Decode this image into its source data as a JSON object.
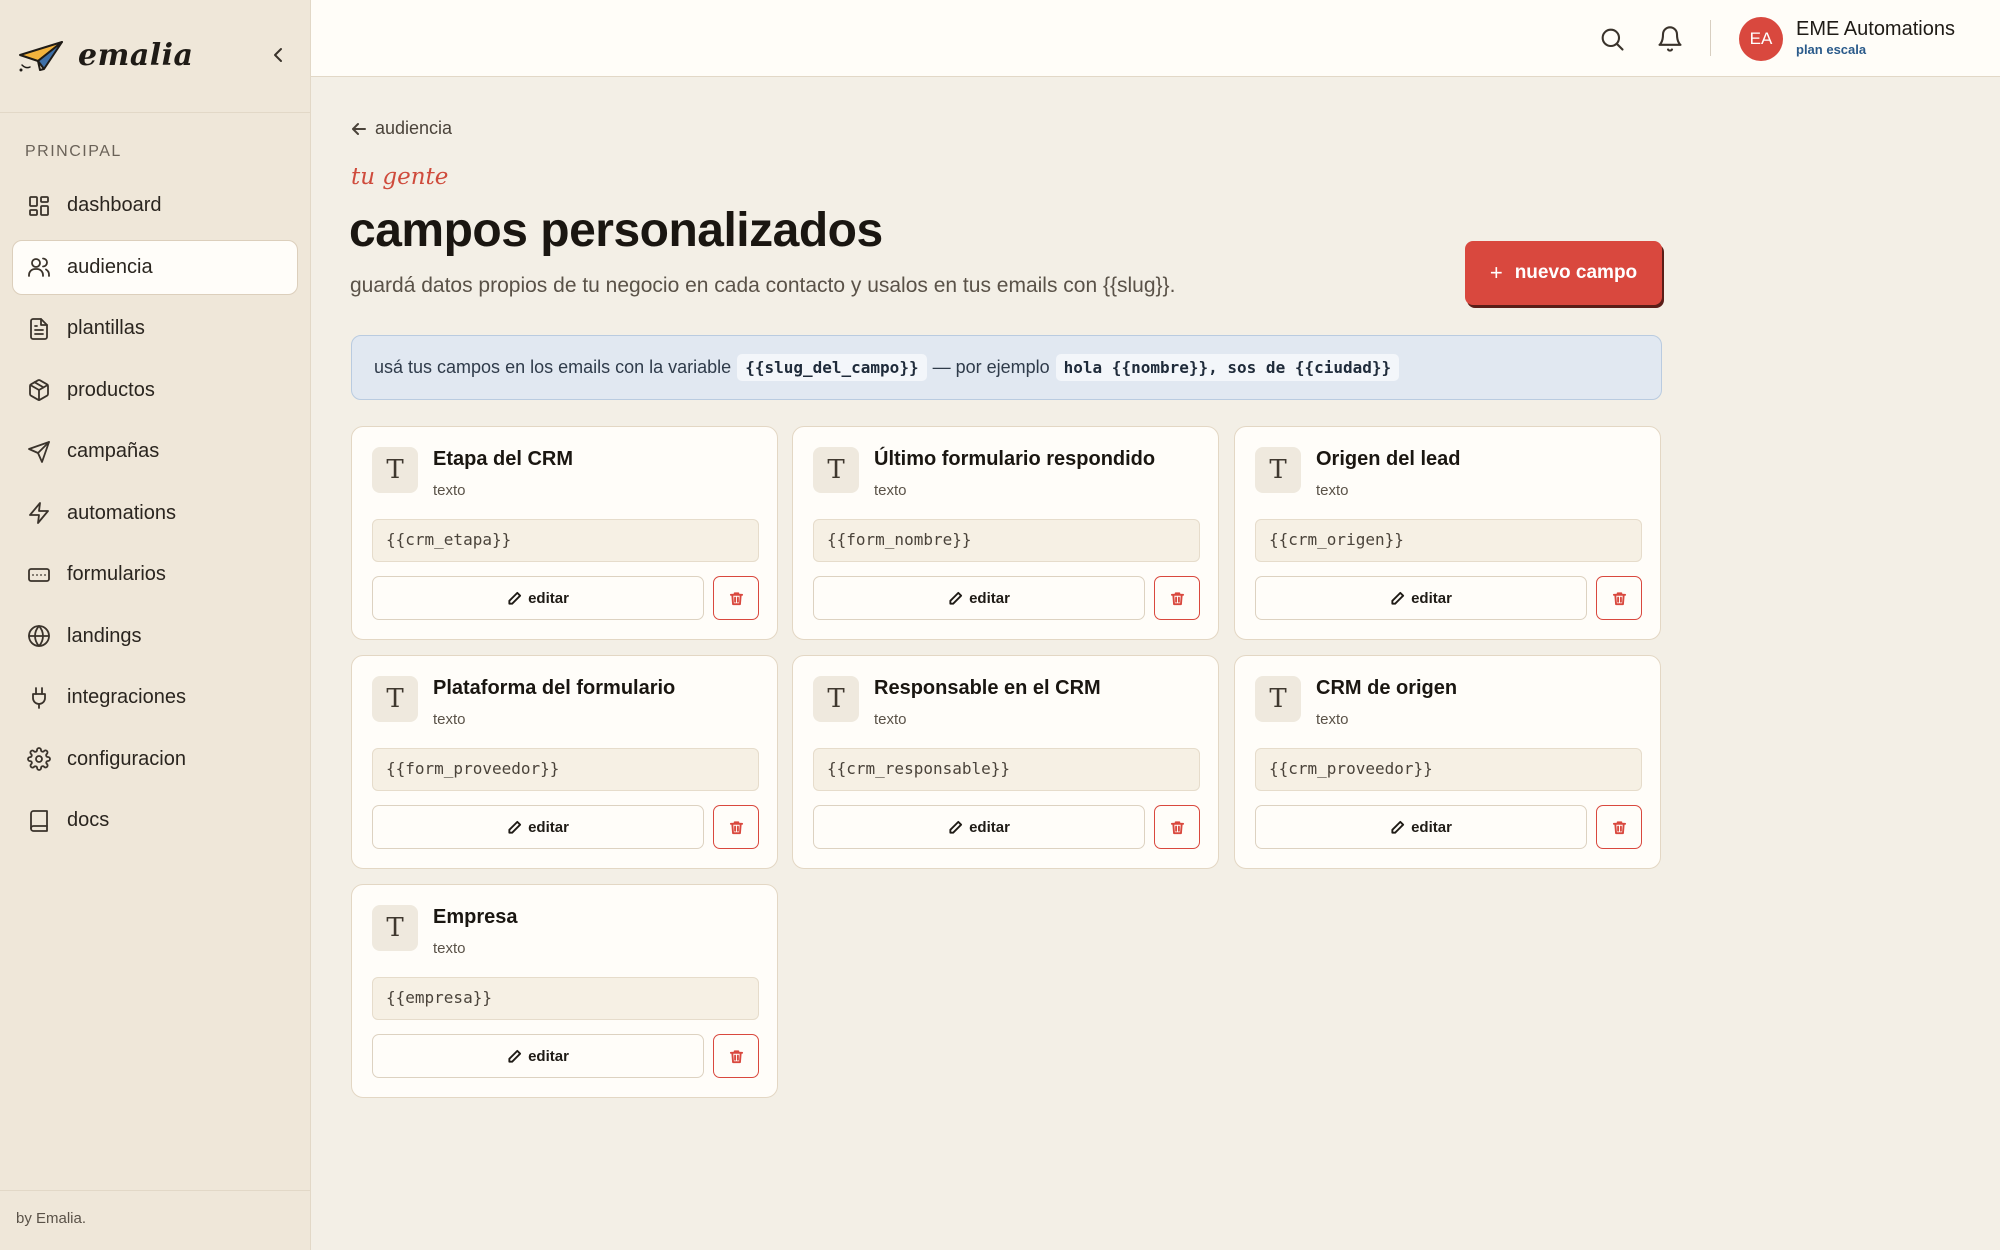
{
  "app": {
    "name": "emalia",
    "footer": "by Emalia."
  },
  "sidebar": {
    "section_label": "PRINCIPAL",
    "items": [
      {
        "label": "dashboard",
        "icon": "dashboard-icon"
      },
      {
        "label": "audiencia",
        "icon": "users-icon",
        "active": true
      },
      {
        "label": "plantillas",
        "icon": "document-icon"
      },
      {
        "label": "productos",
        "icon": "box-icon"
      },
      {
        "label": "campañas",
        "icon": "send-icon"
      },
      {
        "label": "automations",
        "icon": "bolt-icon"
      },
      {
        "label": "formularios",
        "icon": "form-icon"
      },
      {
        "label": "landings",
        "icon": "globe-icon"
      },
      {
        "label": "integraciones",
        "icon": "plug-icon"
      },
      {
        "label": "configuracion",
        "icon": "gear-icon"
      },
      {
        "label": "docs",
        "icon": "book-icon"
      }
    ]
  },
  "topbar": {
    "avatar_initials": "EA",
    "account_name": "EME Automations",
    "plan": "plan escala"
  },
  "page": {
    "back_label": "audiencia",
    "eyebrow": "tu gente",
    "title": "campos personalizados",
    "subtitle": "guardá datos propios de tu negocio en cada contacto y usalos en tus emails con {{slug}}.",
    "new_button": "nuevo campo",
    "info": {
      "text_before": "usá tus campos en los emails con la variable",
      "code_var": "{{slug_del_campo}}",
      "text_middle": "— por ejemplo",
      "code_example": "hola {{nombre}}, sos de {{ciudad}}"
    }
  },
  "cards": [
    {
      "title": "Etapa del CRM",
      "type": "texto",
      "slug": "{{crm_etapa}}",
      "icon_glyph": "T",
      "edit_label": "editar"
    },
    {
      "title": "Último formulario respondido",
      "type": "texto",
      "slug": "{{form_nombre}}",
      "icon_glyph": "T",
      "edit_label": "editar"
    },
    {
      "title": "Origen del lead",
      "type": "texto",
      "slug": "{{crm_origen}}",
      "icon_glyph": "T",
      "edit_label": "editar"
    },
    {
      "title": "Plataforma del formulario",
      "type": "texto",
      "slug": "{{form_proveedor}}",
      "icon_glyph": "T",
      "edit_label": "editar"
    },
    {
      "title": "Responsable en el CRM",
      "type": "texto",
      "slug": "{{crm_responsable}}",
      "icon_glyph": "T",
      "edit_label": "editar"
    },
    {
      "title": "CRM de origen",
      "type": "texto",
      "slug": "{{crm_proveedor}}",
      "icon_glyph": "T",
      "edit_label": "editar"
    },
    {
      "title": "Empresa",
      "type": "texto",
      "slug": "{{empresa}}",
      "icon_glyph": "T",
      "edit_label": "editar"
    }
  ],
  "colors": {
    "accent": "#d9483e",
    "background": "#f3efe6",
    "sidebar": "#efe7d9",
    "info_bg": "#e1e8f1"
  }
}
